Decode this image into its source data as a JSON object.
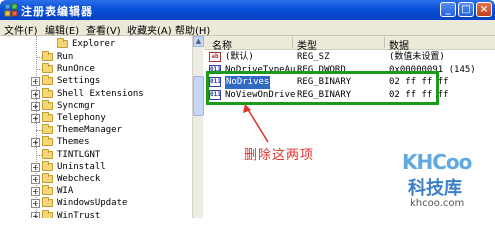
{
  "window": {
    "title": "注册表编辑器",
    "controls": {
      "minimize": "_",
      "maximize": "□",
      "close": "×"
    }
  },
  "menu": [
    "文件(F)",
    "编辑(E)",
    "查看(V)",
    "收藏夹(A)",
    "帮助(H)"
  ],
  "tree": {
    "top_item": "Explorer",
    "items": [
      "Run",
      "RunOnce",
      "Settings",
      "Shell Extensions",
      "Syncmgr",
      "Telephony",
      "ThemeManager",
      "Themes",
      "TINTLGNT",
      "Uninstall",
      "Webcheck",
      "WIA",
      "WindowsUpdate",
      "WinTrust"
    ],
    "expandable": [
      false,
      false,
      true,
      true,
      true,
      true,
      false,
      true,
      false,
      true,
      true,
      true,
      true,
      true
    ]
  },
  "list": {
    "columns": {
      "name": "名称",
      "type": "类型",
      "data": "数据"
    },
    "rows": [
      {
        "icon": "string-value-icon",
        "name": "(默认)",
        "type": "REG_SZ",
        "data": "(数值未设置)"
      },
      {
        "icon": "binary-value-icon",
        "name": "NoDriveTypeAu...",
        "type": "REG_DWORD",
        "data": "0x00000091 (145)"
      },
      {
        "icon": "binary-value-icon",
        "name": "NoDrives",
        "type": "REG_BINARY",
        "data": "02 ff ff ff",
        "selected": true
      },
      {
        "icon": "binary-value-icon",
        "name": "NoViewOnDrive",
        "type": "REG_BINARY",
        "data": "02 ff ff ff"
      }
    ]
  },
  "annotation": {
    "text": "删除这两项",
    "color": "#e0302a",
    "box_color": "#1a9a1a"
  },
  "watermark": {
    "logo": "KHCoo",
    "name": "科技库",
    "url": "khcoo.com"
  }
}
